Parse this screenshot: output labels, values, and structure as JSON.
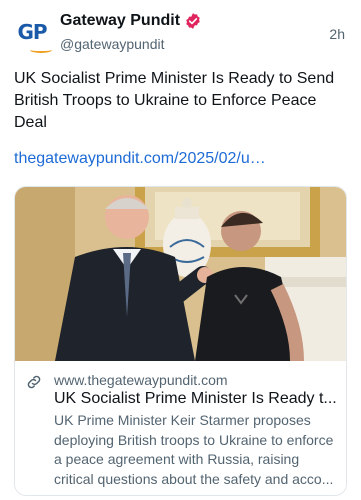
{
  "author": {
    "display_name": "Gateway Pundit",
    "handle": "@gatewaypundit",
    "avatar_text": "GP",
    "verified_icon": "verified-badge-icon"
  },
  "post": {
    "timestamp": "2h",
    "text": "UK Socialist Prime Minister Is Ready to Send British Troops to Ukraine to Enforce Peace Deal",
    "link_text": "thegatewaypundit.com/2025/02/u…"
  },
  "card": {
    "domain": "www.thegatewaypundit.com",
    "title": "UK Socialist Prime Minister Is Ready t...",
    "description": "UK Prime Minister Keir Starmer proposes deploying British troops to Ukraine to enforce a peace agreement with Russia, raising critical questions about the safety and acco...",
    "link_icon": "link-icon"
  },
  "colors": {
    "link": "#1d6bd6",
    "secondary_text": "#536471",
    "verified": "#e0245e",
    "brand_blue": "#1a5aa8",
    "brand_orange": "#f0a020"
  }
}
